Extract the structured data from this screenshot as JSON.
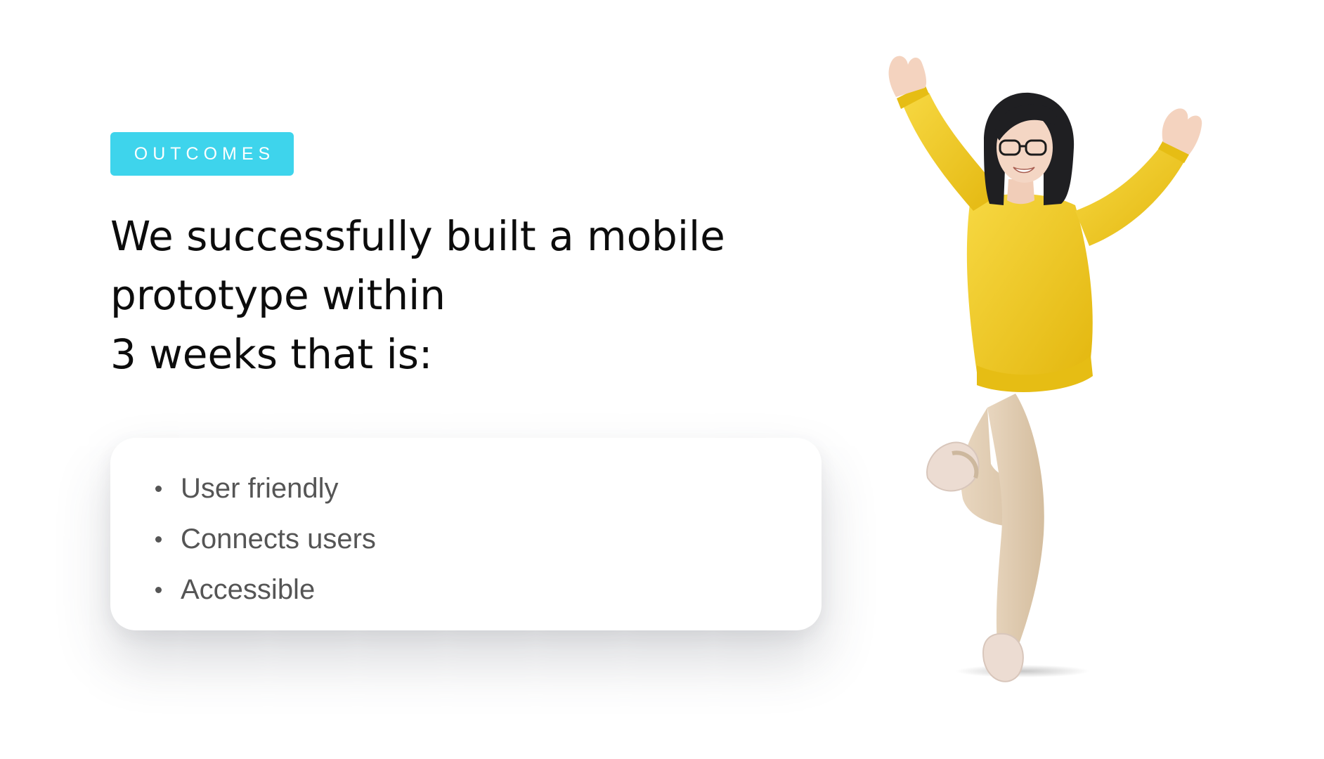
{
  "badge": {
    "label": "OUTCOMES"
  },
  "headline": {
    "lines": [
      "We successfully built a mobile",
      "prototype within",
      "3 weeks that is:"
    ]
  },
  "outcomes": {
    "items": [
      {
        "label": "User friendly"
      },
      {
        "label": "Connects users"
      },
      {
        "label": "Accessible"
      }
    ]
  },
  "illustration": {
    "icon": "celebrating-person-illustration"
  },
  "colors": {
    "accent": "#3ed4ec",
    "headline": "#0c0c0c",
    "list_text": "#555555",
    "sweater": "#f3cd23",
    "pants": "#e6d2b8"
  }
}
